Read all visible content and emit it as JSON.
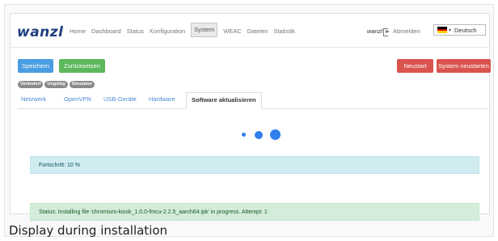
{
  "header": {
    "brand": "wanzl",
    "nav": [
      {
        "label": "Home"
      },
      {
        "label": "Dashboard"
      },
      {
        "label": "Status"
      },
      {
        "label": "Konfiguration"
      },
      {
        "label": "System",
        "active": true
      },
      {
        "label": "WEAC"
      },
      {
        "label": "Dateien"
      },
      {
        "label": "Statistik"
      }
    ],
    "user": "wanzl",
    "logout_label": "Abmelden",
    "logout_icon": "sign-out-icon",
    "language": {
      "selected": "Deutsch",
      "flag_colors": [
        "#000000",
        "#dd0000",
        "#ffce00"
      ]
    }
  },
  "toolbar": {
    "save_label": "Speichern",
    "reset_label": "Zurücksetzen",
    "restart_label": "Neustart",
    "system_restart_label": "System neustarten"
  },
  "badges": [
    "Verändert",
    "Ungültig",
    "Simulator"
  ],
  "tabs": [
    {
      "label": "Netzwerk"
    },
    {
      "label": "OpenVPN"
    },
    {
      "label": "USB-Geräte"
    },
    {
      "label": "Hardware"
    },
    {
      "label": "Software aktualisieren",
      "active": true
    }
  ],
  "progress": {
    "label": "Fortschritt: 10 %",
    "percent": 10
  },
  "status": {
    "message": "Status: Installing file 'chromium-kiosk_1.0.0-fmcu-2.2.5_aarch64.ipk' in progress. Attempt: 1"
  },
  "caption": "Display during installation",
  "colors": {
    "brand": "#1f3e7d",
    "primary": "#4a9de1",
    "success": "#5cb85c",
    "danger": "#d9534f",
    "link": "#4a8ad4",
    "spinner": "#2f80ed",
    "info_bg": "#d1ecf1",
    "success_bg": "#d4edda"
  }
}
